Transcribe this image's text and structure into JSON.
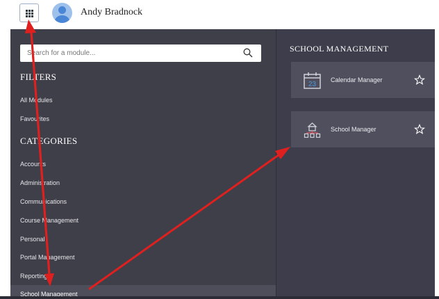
{
  "header": {
    "user_name": "Andy Bradnock",
    "apps_icon": "apps-grid-icon",
    "avatar_icon": "user-avatar-icon"
  },
  "sidebar": {
    "search_placeholder": "Search for a module...",
    "filters_title": "FILTERS",
    "filters": [
      "All Modules",
      "Favourites"
    ],
    "categories_title": "CATEGORIES",
    "categories": [
      "Accounts",
      "Administration",
      "Communications",
      "Course Management",
      "Personal",
      "Portal Management",
      "Reporting",
      "School Management"
    ],
    "selected_category": "School Management"
  },
  "main": {
    "title": "SCHOOL MANAGEMENT",
    "modules": [
      {
        "label": "Calendar Manager",
        "icon": "calendar-icon",
        "calendar_day": "23"
      },
      {
        "label": "School Manager",
        "icon": "school-hierarchy-icon"
      }
    ]
  },
  "colors": {
    "sidebar_bg": "#3f3f4a",
    "main_bg": "#3d3d4c",
    "card_bg": "#4f4f5e",
    "annotation_arrow": "#e0201e",
    "calendar_accent": "#4a9be0",
    "school_accent": "#e05a6a"
  }
}
